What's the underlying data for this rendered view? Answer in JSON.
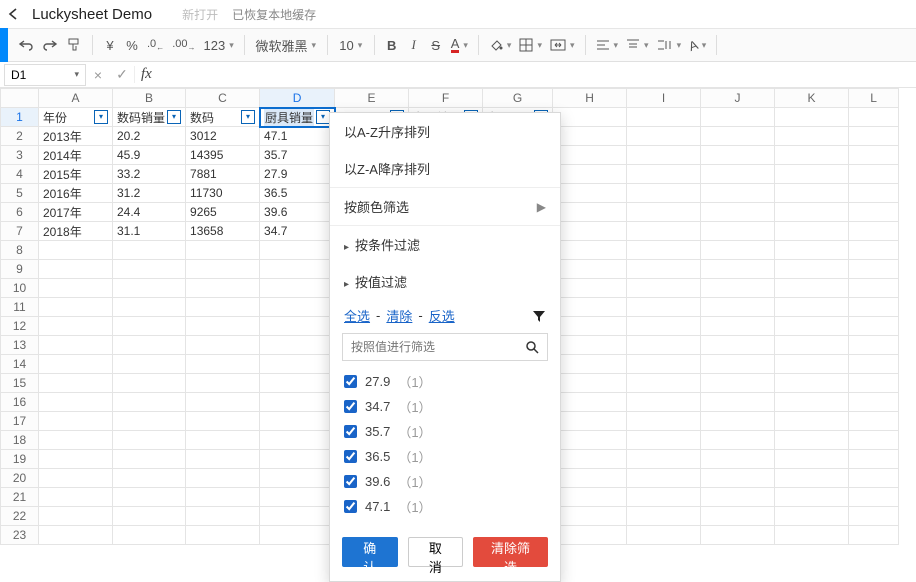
{
  "app": {
    "title": "Luckysheet Demo",
    "hint": "新打开",
    "status": "已恢复本地缓存"
  },
  "toolbar": {
    "currency": "¥",
    "percent": "%",
    "dec_dec": ".0",
    "dec_inc": ".00",
    "numfmt": "123",
    "font": "微软雅黑",
    "font_size": "10",
    "bold": "B",
    "italic": "I",
    "strike": "S",
    "textcolor": "A"
  },
  "formula": {
    "name": "D1",
    "fx": "fx",
    "value": ""
  },
  "columns": [
    "A",
    "B",
    "C",
    "D",
    "E",
    "F",
    "G",
    "H",
    "I",
    "J",
    "K",
    "L"
  ],
  "headers": {
    "A": "年份",
    "B": "数码销量",
    "C": "数码",
    "D": "厨具销量",
    "E": "厨具",
    "F": "办公销量",
    "G": "办公"
  },
  "rows": [
    {
      "A": "2013年",
      "B": "20.2",
      "C": "3012",
      "D": "47.1"
    },
    {
      "A": "2014年",
      "B": "45.9",
      "C": "14395",
      "D": "35.7"
    },
    {
      "A": "2015年",
      "B": "33.2",
      "C": "7881",
      "D": "27.9"
    },
    {
      "A": "2016年",
      "B": "31.2",
      "C": "11730",
      "D": "36.5"
    },
    {
      "A": "2017年",
      "B": "24.4",
      "C": "9265",
      "D": "39.6"
    },
    {
      "A": "2018年",
      "B": "31.1",
      "C": "13658",
      "D": "34.7"
    }
  ],
  "total_rows": 23,
  "filter_panel": {
    "sort_asc": "以A-Z升序排列",
    "sort_desc": "以Z-A降序排列",
    "by_color": "按颜色筛选",
    "by_condition": "按条件过滤",
    "by_value": "按值过滤",
    "select_all": "全选",
    "clear": "清除",
    "invert": "反选",
    "search_placeholder": "按照值进行筛选",
    "values": [
      {
        "v": "27.9",
        "c": "1"
      },
      {
        "v": "34.7",
        "c": "1"
      },
      {
        "v": "35.7",
        "c": "1"
      },
      {
        "v": "36.5",
        "c": "1"
      },
      {
        "v": "39.6",
        "c": "1"
      },
      {
        "v": "47.1",
        "c": "1"
      }
    ],
    "ok": "确 认",
    "cancel": "取 消",
    "clear_filter": "清除筛选"
  }
}
